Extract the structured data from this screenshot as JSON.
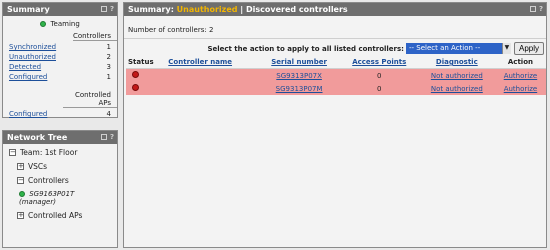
{
  "summary": {
    "title": "Summary",
    "teaming": "Teaming",
    "controllers_header": "Controllers",
    "rows": [
      {
        "label": "Synchronized",
        "value": "1"
      },
      {
        "label": "Unauthorized",
        "value": "2"
      },
      {
        "label": "Detected",
        "value": "3"
      },
      {
        "label": "Configured",
        "value": "1"
      }
    ],
    "aps_header": "Controlled APs",
    "aps_rows": [
      {
        "label": "Configured",
        "value": "4"
      }
    ]
  },
  "tree": {
    "title": "Network Tree",
    "team": "Team: 1st Floor",
    "vscs": "VSCs",
    "controllers": "Controllers",
    "controller_item": "SG9163P01T",
    "controller_role": "(manager)",
    "aps": "Controlled APs"
  },
  "main": {
    "title_prefix": "Summary: ",
    "title_highlight": "Unauthorized",
    "title_sep": " | ",
    "title_rest": "Discovered controllers",
    "count_text": "Number of controllers: 2",
    "action_label": "Select the action to apply to all listed controllers:",
    "select_value": "-- Select an Action --",
    "apply_label": "Apply",
    "columns": {
      "status": "Status",
      "name": "Controller name",
      "serial": "Serial number",
      "aps": "Access Points",
      "diag": "Diagnostic",
      "action": "Action"
    },
    "rows": [
      {
        "name": "",
        "serial": "SG9313P07X",
        "aps": "0",
        "diag": "Not authorized",
        "action": "Authorize"
      },
      {
        "name": "",
        "serial": "SG9313P07M",
        "aps": "0",
        "diag": "Not authorized",
        "action": "Authorize"
      }
    ]
  },
  "colors": {
    "header_bg": "#6e6e6e",
    "highlight": "#f2b400",
    "error_row": "#f19b9b",
    "ok_dot": "#2fb34a",
    "err_dot": "#c21818",
    "select_bg": "#2d63c7"
  },
  "icons": [
    "collapse-icon",
    "help-icon",
    "green-status-icon",
    "red-status-icon",
    "expand-icon",
    "dropdown-arrow-icon"
  ]
}
